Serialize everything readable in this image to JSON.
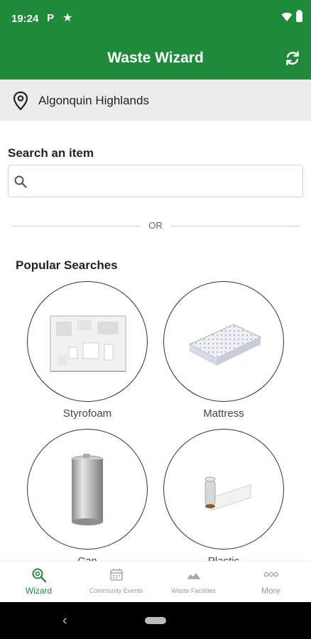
{
  "status_bar": {
    "time": "19:24",
    "icons": [
      "parking-icon",
      "star-icon",
      "wifi-icon",
      "battery-icon"
    ],
    "parking_glyph": "P",
    "star_glyph": "★"
  },
  "app_bar": {
    "title": "Waste Wizard",
    "refresh_icon": "refresh-icon",
    "background_color": "#1f8a3a"
  },
  "location": {
    "name": "Algonquin Highlands",
    "icon": "location-pin-icon"
  },
  "search": {
    "label": "Search an item",
    "value": "",
    "placeholder": "",
    "icon": "search-icon"
  },
  "divider": {
    "text": "OR"
  },
  "popular": {
    "title": "Popular Searches",
    "items": [
      {
        "label": "Styrofoam",
        "icon": "styrofoam-image"
      },
      {
        "label": "Mattress",
        "icon": "mattress-image"
      },
      {
        "label": "Can",
        "icon": "can-image"
      },
      {
        "label": "Plastic",
        "icon": "plastic-roll-image"
      }
    ]
  },
  "bottom_nav": {
    "items": [
      {
        "label": "Wizard",
        "icon": "wizard-search-icon",
        "active": true
      },
      {
        "label": "Community Events",
        "icon": "calendar-icon",
        "active": false
      },
      {
        "label": "Waste Facilities",
        "icon": "facilities-icon",
        "active": false
      },
      {
        "label": "More",
        "icon": "more-icon",
        "active": false
      }
    ],
    "active_color": "#1f8a3a"
  },
  "system_nav": {
    "back_glyph": "‹"
  }
}
